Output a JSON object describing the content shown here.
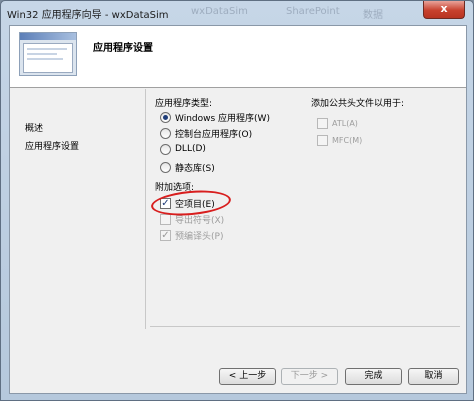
{
  "window": {
    "title": "Win32 应用程序向导 - wxDataSim",
    "background_ghost_1": "wxDataSim",
    "background_ghost_2": "SharePoint",
    "background_ghost_3": "数据",
    "close_glyph": "x"
  },
  "header": {
    "title": "应用程序设置"
  },
  "nav": {
    "items": [
      {
        "label": "概述"
      },
      {
        "label": "应用程序设置"
      }
    ]
  },
  "app_type": {
    "label": "应用程序类型:",
    "options": [
      {
        "label": "Windows 应用程序(W)",
        "selected": true
      },
      {
        "label": "控制台应用程序(O)",
        "selected": false
      },
      {
        "label": "DLL(D)",
        "selected": false
      },
      {
        "label": "静态库(S)",
        "selected": false
      }
    ]
  },
  "additional": {
    "label": "附加选项:",
    "options": [
      {
        "label": "空项目(E)",
        "checked": true,
        "enabled": true
      },
      {
        "label": "导出符号(X)",
        "checked": false,
        "enabled": false
      },
      {
        "label": "预编译头(P)",
        "checked": true,
        "enabled": false
      }
    ]
  },
  "common_headers": {
    "label": "添加公共头文件以用于:",
    "options": [
      {
        "label": "ATL(A)",
        "checked": false,
        "enabled": false
      },
      {
        "label": "MFC(M)",
        "checked": false,
        "enabled": false
      }
    ]
  },
  "buttons": {
    "prev": "< 上一步",
    "next": "下一步 >",
    "finish": "完成",
    "cancel": "取消"
  },
  "check_glyph": "✓"
}
